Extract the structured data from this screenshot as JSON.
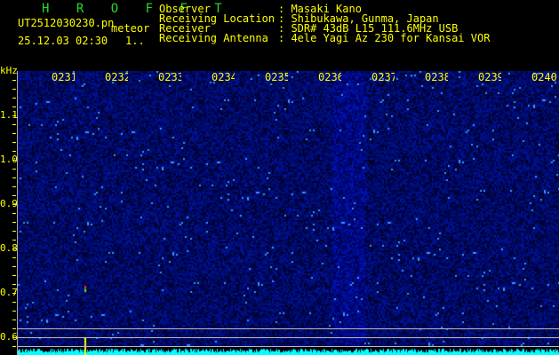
{
  "header": {
    "app_title": "H R O F F T",
    "file_name": "UT2512030230.pn",
    "mode": "meteor",
    "datetime": "25.12.03 02:30",
    "count": "1.."
  },
  "station": [
    {
      "label": "Observer",
      "value": "Masaki Kano"
    },
    {
      "label": "Receiving Location",
      "value": "Shibukawa, Gunma, Japan"
    },
    {
      "label": "Receiver",
      "value": "SDR# 43dB L15 111.6MHz USB"
    },
    {
      "label": "Receiving Antenna",
      "value": "4ele Yagi Az 230 for Kansai VOR"
    }
  ],
  "axis": {
    "unit": "kHz",
    "freq_labels": [
      "1.1",
      "1.0",
      "0.9",
      "0.8",
      "0.7",
      "0.6"
    ],
    "time_labels": [
      "0231",
      "0232",
      "0233",
      "0234",
      "0235",
      "0236",
      "0237",
      "0238",
      "0239",
      "0240"
    ]
  },
  "colors": {
    "text": "#ffff00",
    "title": "#22dd22",
    "background": "#000000",
    "noise": "#0000cc",
    "spectrum": "#00ffff"
  }
}
